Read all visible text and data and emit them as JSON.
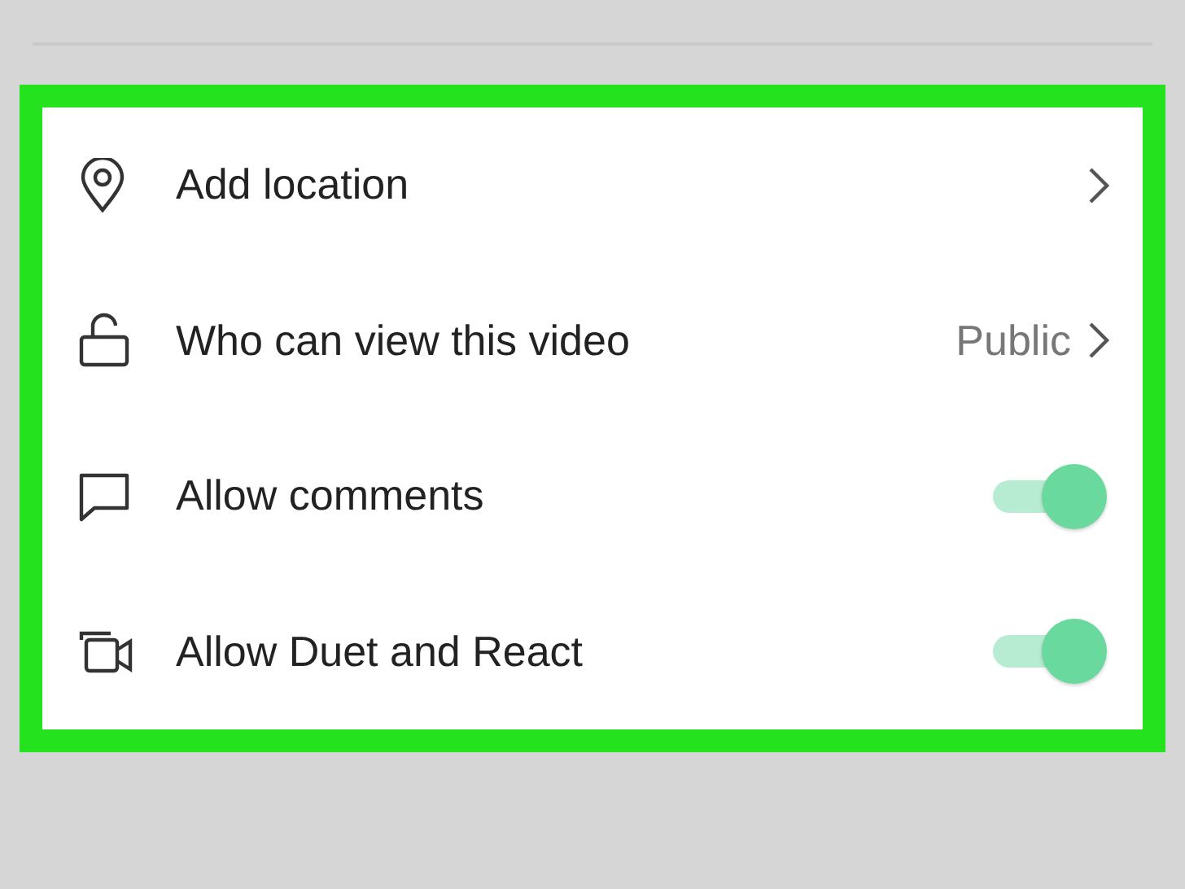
{
  "settings": [
    {
      "kind": "link",
      "label": "Add location"
    },
    {
      "kind": "link",
      "label": "Who can view this video",
      "value": "Public"
    },
    {
      "kind": "toggle",
      "label": "Allow comments",
      "on": true
    },
    {
      "kind": "toggle",
      "label": "Allow Duet and React",
      "on": true
    }
  ]
}
